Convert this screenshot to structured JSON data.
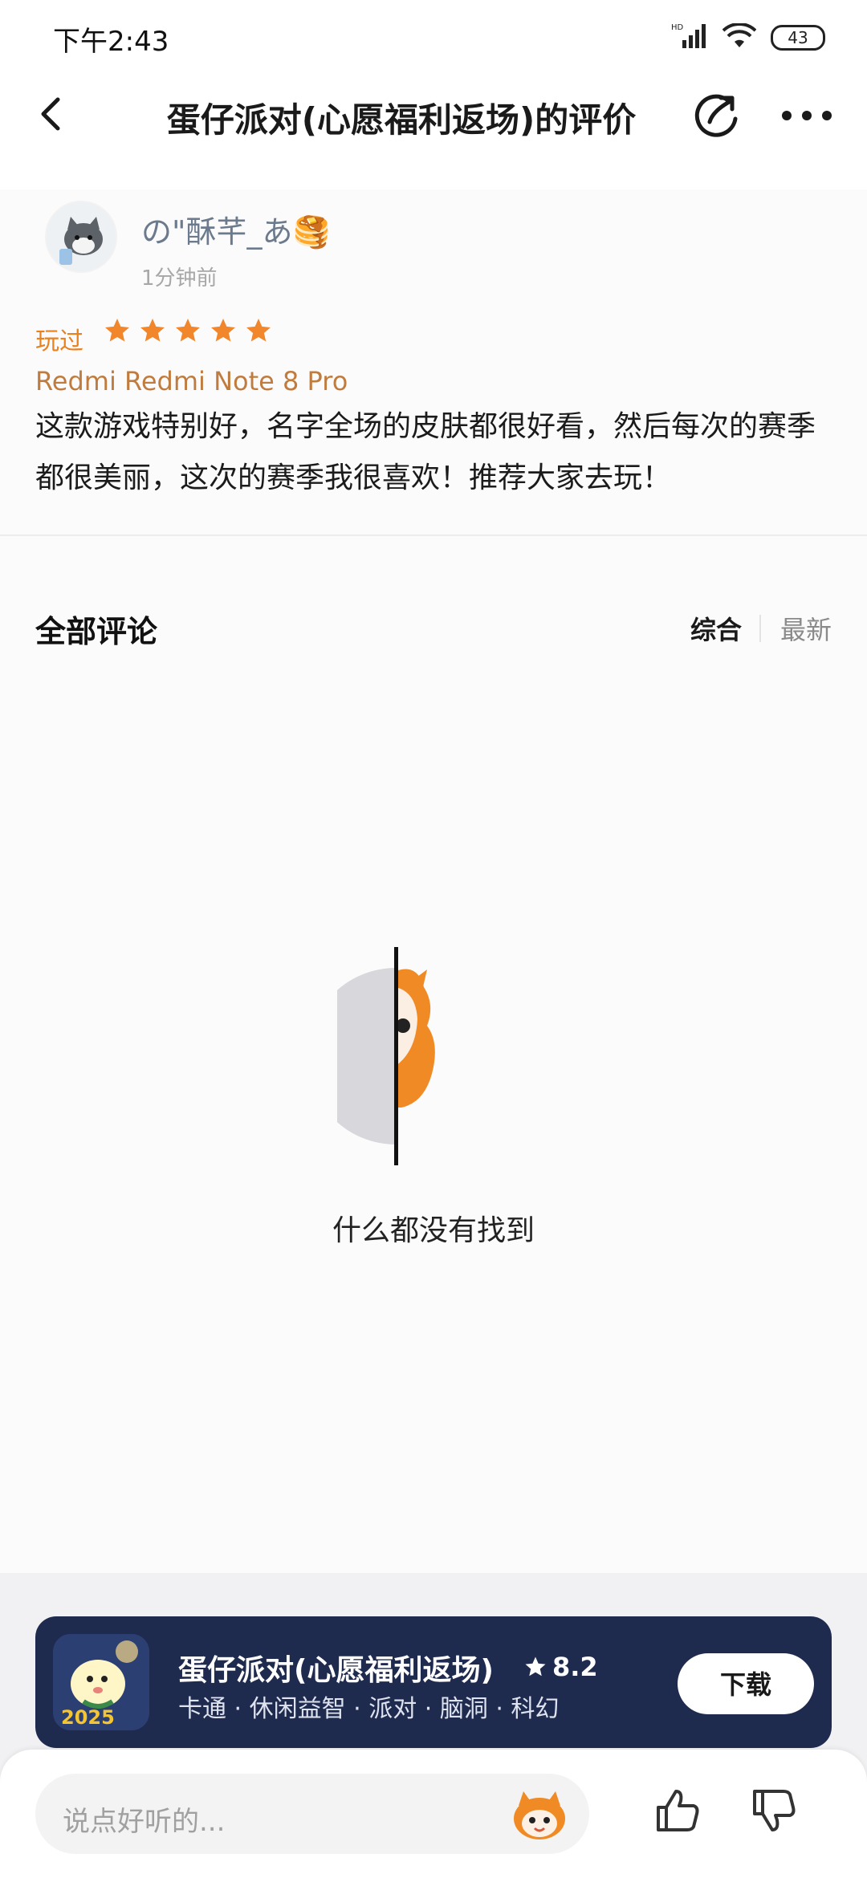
{
  "status_bar": {
    "time": "下午2:43",
    "network": "HD",
    "battery": "43"
  },
  "header": {
    "title": "蛋仔派对(心愿福利返场)的评价"
  },
  "review": {
    "username": "の\"酥芊_あ🥞",
    "time_ago": "1分钟前",
    "played_label": "玩过",
    "rating": 5,
    "device": "Redmi Redmi Note 8 Pro",
    "text": "这款游戏特别好，名字全场的皮肤都很好看，然后每次的赛季都很美丽，这次的赛季我很喜欢！推荐大家去玩！"
  },
  "comments": {
    "title": "全部评论",
    "sort_general": "综合",
    "sort_newest": "最新",
    "empty_text": "什么都没有找到"
  },
  "app_card": {
    "name": "蛋仔派对(心愿福利返场)",
    "rating": "8.2",
    "tags": "卡通 · 休闲益智 · 派对 · 脑洞 · 科幻",
    "download_label": "下载",
    "icon_year": "2025"
  },
  "bottom_bar": {
    "input_placeholder": "说点好听的..."
  },
  "colors": {
    "accent_orange": "#e8811e",
    "card_bg": "#1f2b4e",
    "username": "#6b7a8c"
  }
}
